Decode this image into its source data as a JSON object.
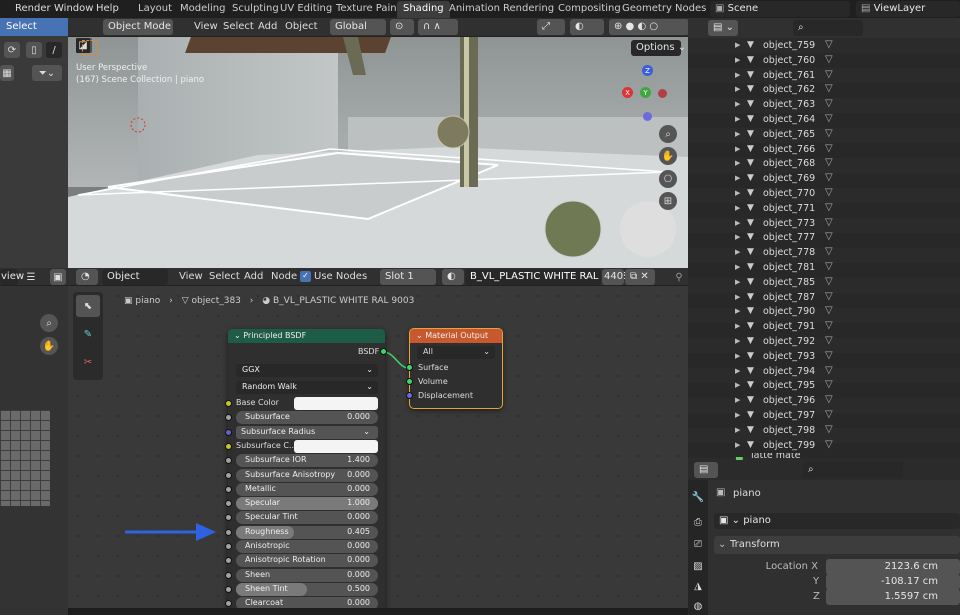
{
  "topbar": {
    "menus": [
      "Render",
      "Window",
      "Help"
    ],
    "tabs": [
      "Layout",
      "Modeling",
      "Sculpting",
      "UV Editing",
      "Texture Paint",
      "Shading",
      "Animation",
      "Rendering",
      "Compositing",
      "Geometry Nodes"
    ],
    "scene": "Scene",
    "view_layer": "ViewLayer"
  },
  "left": {
    "select_label": "Select"
  },
  "viewport": {
    "mode": "Object Mode",
    "menus": [
      "View",
      "Select",
      "Add",
      "Object"
    ],
    "transform": "Global",
    "options": "Options",
    "overlay_line1": "User Perspective",
    "overlay_line2": "(167) Scene Collection | piano",
    "gizmo": {
      "z": "Z",
      "x": "X",
      "y": "Y"
    }
  },
  "node_editor": {
    "editor_type": "view",
    "object_menu": "Object",
    "menus": [
      "View",
      "Select",
      "Add",
      "Node"
    ],
    "use_nodes": "Use Nodes",
    "slot": "Slot 1",
    "material": "B_VL_PLASTIC WHITE RAL 9003",
    "users": "440",
    "breadcrumb": {
      "a": "piano",
      "b": "object_383",
      "c": "B_VL_PLASTIC WHITE RAL 9003"
    }
  },
  "bsdf": {
    "title": "Principled BSDF",
    "output": "BSDF",
    "distribution": "GGX",
    "subsurface_method": "Random Walk",
    "fields": [
      {
        "label": "Base Color",
        "value": "",
        "kind": "color",
        "sock": "yellow"
      },
      {
        "label": "Subsurface",
        "value": "0.000",
        "kind": "num",
        "sock": "gray"
      },
      {
        "label": "Subsurface Radius",
        "value": "",
        "kind": "dd",
        "sock": "blue"
      },
      {
        "label": "Subsurface C...",
        "value": "",
        "kind": "color",
        "sock": "yellow"
      },
      {
        "label": "Subsurface IOR",
        "value": "1.400",
        "kind": "num",
        "sock": "gray"
      },
      {
        "label": "Subsurface Anisotropy",
        "value": "0.000",
        "kind": "num",
        "sock": "gray"
      },
      {
        "label": "Metallic",
        "value": "0.000",
        "kind": "num",
        "sock": "gray"
      },
      {
        "label": "Specular",
        "value": "1.000",
        "kind": "num",
        "sock": "gray"
      },
      {
        "label": "Specular Tint",
        "value": "0.000",
        "kind": "num",
        "sock": "gray"
      },
      {
        "label": "Roughness",
        "value": "0.405",
        "kind": "num",
        "sock": "gray"
      },
      {
        "label": "Anisotropic",
        "value": "0.000",
        "kind": "num",
        "sock": "gray"
      },
      {
        "label": "Anisotropic Rotation",
        "value": "0.000",
        "kind": "num",
        "sock": "gray"
      },
      {
        "label": "Sheen",
        "value": "0.000",
        "kind": "num",
        "sock": "gray"
      },
      {
        "label": "Sheen Tint",
        "value": "0.500",
        "kind": "num",
        "sock": "gray"
      },
      {
        "label": "Clearcoat",
        "value": "0.000",
        "kind": "num",
        "sock": "gray"
      }
    ]
  },
  "mat_output": {
    "title": "Material Output",
    "target": "All",
    "inputs": [
      "Surface",
      "Volume",
      "Displacement"
    ]
  },
  "outliner": {
    "items": [
      "object_759",
      "object_760",
      "object_761",
      "object_762",
      "object_763",
      "object_764",
      "object_765",
      "object_766",
      "object_768",
      "object_769",
      "object_770",
      "object_771",
      "object_773",
      "object_777",
      "object_778",
      "object_781",
      "object_785",
      "object_787",
      "object_790",
      "object_791",
      "object_792",
      "object_793",
      "object_794",
      "object_795",
      "object_796",
      "object_797",
      "object_798",
      "object_799"
    ],
    "partial": "latte mate"
  },
  "properties": {
    "object": "piano",
    "name": "piano",
    "section": "Transform",
    "location": [
      {
        "axis": "Location X",
        "value": "2123.6 cm"
      },
      {
        "axis": "Y",
        "value": "-108.17 cm"
      },
      {
        "axis": "Z",
        "value": "1.5597 cm"
      }
    ]
  },
  "colors": {
    "accent": "#4772b3",
    "arrow": "#2f62e0",
    "output_hdr": "#c8592e",
    "bsdf_hdr": "#1f5c47"
  }
}
